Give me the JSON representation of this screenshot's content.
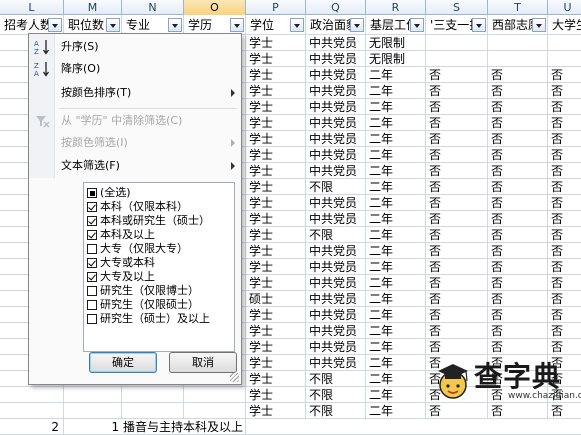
{
  "colors": {
    "header_bg": "#e4ecf7",
    "selected_col": "#f8d27e",
    "grid": "#d0d7e5",
    "menu_bg": "#fafafa"
  },
  "column_letters": [
    "L",
    "M",
    "N",
    "O",
    "P",
    "Q",
    "R",
    "S",
    "T",
    "U"
  ],
  "header_row": [
    "招考人数",
    "职位数",
    "专业",
    "学历",
    "学位",
    "政治面貌",
    "基层工作",
    "'三支一扶'",
    "西部志愿",
    "大学生"
  ],
  "rows": [
    [
      "学士",
      "中共党员",
      "无限制",
      "",
      "",
      ""
    ],
    [
      "学士",
      "中共党员",
      "无限制",
      "",
      "",
      ""
    ],
    [
      "学士",
      "中共党员",
      "二年",
      "否",
      "否",
      "否"
    ],
    [
      "学士",
      "中共党员",
      "二年",
      "否",
      "否",
      "否"
    ],
    [
      "学士",
      "中共党员",
      "二年",
      "否",
      "否",
      "否"
    ],
    [
      "学士",
      "中共党员",
      "二年",
      "否",
      "否",
      "否"
    ],
    [
      "学士",
      "中共党员",
      "二年",
      "否",
      "否",
      "否"
    ],
    [
      "学士",
      "中共党员",
      "二年",
      "否",
      "否",
      "否"
    ],
    [
      "学士",
      "中共党员",
      "二年",
      "否",
      "否",
      "否"
    ],
    [
      "学士",
      "不限",
      "二年",
      "否",
      "否",
      "否"
    ],
    [
      "学士",
      "中共党员",
      "二年",
      "否",
      "否",
      "否"
    ],
    [
      "学士",
      "中共党员",
      "二年",
      "否",
      "否",
      "否"
    ],
    [
      "学士",
      "不限",
      "二年",
      "否",
      "否",
      "否"
    ],
    [
      "学士",
      "中共党员",
      "二年",
      "否",
      "否",
      "否"
    ],
    [
      "学士",
      "中共党员",
      "二年",
      "否",
      "否",
      "否"
    ],
    [
      "学士",
      "中共党员",
      "二年",
      "否",
      "否",
      "否"
    ],
    [
      "硕士",
      "中共党员",
      "二年",
      "否",
      "否",
      "否"
    ],
    [
      "学士",
      "中共党员",
      "二年",
      "否",
      "否",
      "否"
    ],
    [
      "学士",
      "中共党员",
      "二年",
      "否",
      "否",
      "否"
    ],
    [
      "学士",
      "中共党员",
      "二年",
      "否",
      "否",
      "否"
    ],
    [
      "学士",
      "中共党员",
      "二年",
      "否",
      "否",
      "否"
    ],
    [
      "学士",
      "不限",
      "二年",
      "否",
      "否",
      "否"
    ],
    [
      "学士",
      "不限",
      "二年",
      "否",
      "否",
      "否"
    ],
    [
      "学士",
      "不限",
      "二年",
      "否",
      "否",
      "否"
    ]
  ],
  "bottom_row": {
    "num": "2",
    "text": "1 播音与主持本科及以上"
  },
  "menu": {
    "sort_asc": "升序(S)",
    "sort_desc": "降序(O)",
    "sort_by_color": "按颜色排序(T)",
    "clear_filter": "从 \"学历\" 中清除筛选(C)",
    "filter_by_color": "按颜色筛选(I)",
    "text_filter": "文本筛选(F)",
    "items": [
      {
        "label": "(全选)",
        "state": "mixed"
      },
      {
        "label": "本科（仅限本科）",
        "state": "checked"
      },
      {
        "label": "本科或研究生（硕士）",
        "state": "checked"
      },
      {
        "label": "本科及以上",
        "state": "checked"
      },
      {
        "label": "大专（仅限大专）",
        "state": "unchecked"
      },
      {
        "label": "大专或本科",
        "state": "checked"
      },
      {
        "label": "大专及以上",
        "state": "checked"
      },
      {
        "label": "研究生（仅限博士）",
        "state": "unchecked"
      },
      {
        "label": "研究生（仅限硕士）",
        "state": "unchecked"
      },
      {
        "label": "研究生（硕士）及以上",
        "state": "unchecked"
      }
    ],
    "ok": "确定",
    "cancel": "取消"
  },
  "watermark": {
    "text": "查字典",
    "url": "www.chazidian.com",
    "icon": "graduation-cap-icon"
  }
}
